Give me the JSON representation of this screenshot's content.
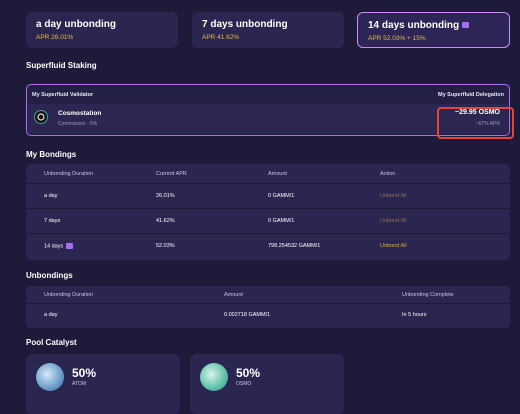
{
  "unbonding_cards": [
    {
      "title": "a day unbonding",
      "apr": "APR 26.01%"
    },
    {
      "title": "7 days unbonding",
      "apr": "APR 41.62%"
    },
    {
      "title": "14 days unbonding",
      "apr": "APR 52.03% + 15%"
    }
  ],
  "superfluid": {
    "title": "Superfluid Staking",
    "validator_header": "My Superfluid Validator",
    "delegation_header": "My Superfluid Delegation",
    "validator_name": "Cosmostation",
    "commission": "Commission - 5%",
    "amount": "~29.95 OSMO",
    "apr": "~67% APR"
  },
  "bondings": {
    "title": "My Bondings",
    "headers": [
      "Unbonding Duration",
      "Current APR",
      "Amount",
      "Action"
    ],
    "rows": [
      {
        "duration": "a day",
        "apr": "26.01%",
        "amount": "0 GAMM/1",
        "action": "Unbond All"
      },
      {
        "duration": "7 days",
        "apr": "41.62%",
        "amount": "0 GAMM/1",
        "action": "Unbond All"
      },
      {
        "duration": "14 days",
        "apr": "52.03%",
        "amount": "798.254532 GAMM/1",
        "action": "Unbond All"
      }
    ]
  },
  "unbondings": {
    "title": "Unbondings",
    "headers": [
      "Unbonding Duration",
      "Amount",
      "Unbonding Complete"
    ],
    "rows": [
      {
        "duration": "a day",
        "amount": "0.002718 GAMM/1",
        "complete": "In 5 hours"
      }
    ]
  },
  "pool_catalyst": {
    "title": "Pool Catalyst",
    "assets": [
      {
        "percent": "50%",
        "symbol": "ATOM"
      },
      {
        "percent": "50%",
        "symbol": "OSMO"
      }
    ]
  },
  "colors": {
    "background": "#1d1a3a",
    "card": "#2a2650",
    "apr_gold": "#e8b84a",
    "selected_border": "#c98ef2",
    "highlight_red": "#e4443a"
  }
}
